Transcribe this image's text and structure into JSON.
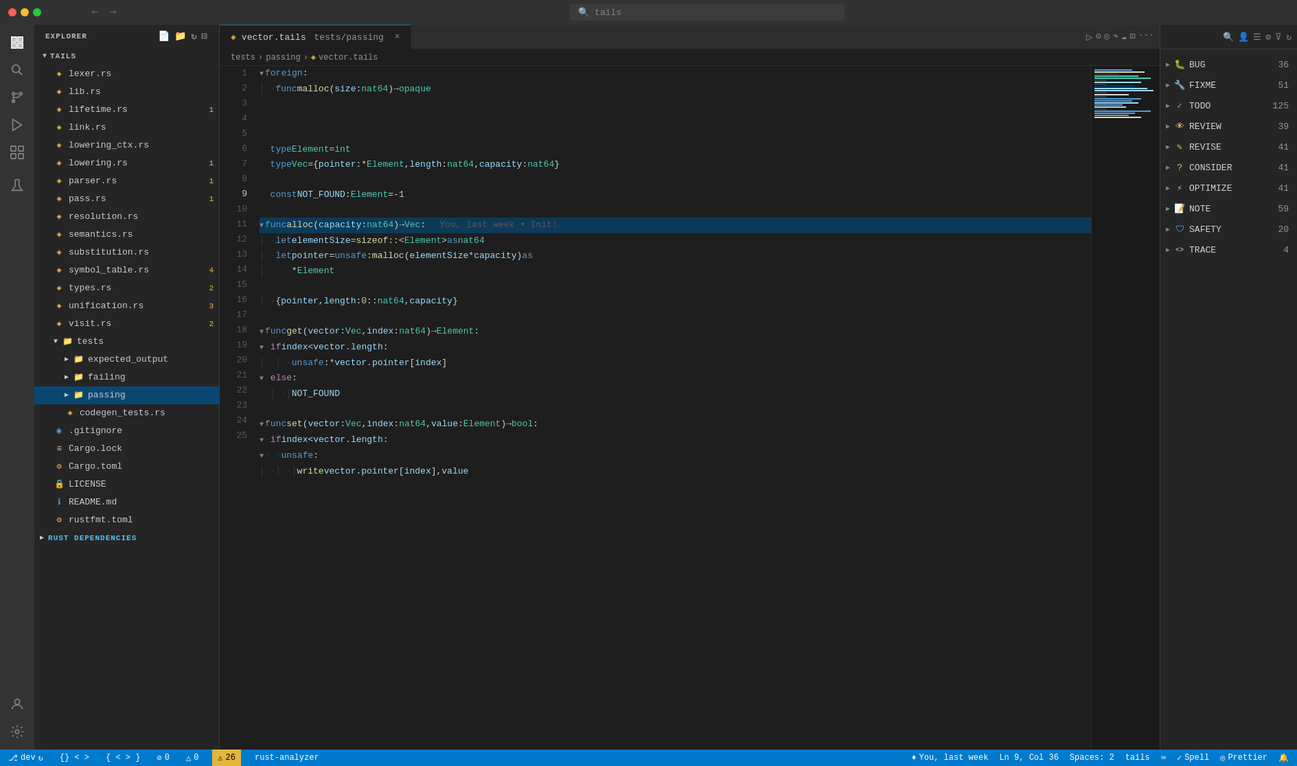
{
  "titleBar": {
    "searchPlaceholder": "tails"
  },
  "activityBar": {
    "items": [
      {
        "name": "explorer",
        "icon": "⧉",
        "active": true
      },
      {
        "name": "search",
        "icon": "🔍",
        "active": false
      },
      {
        "name": "source-control",
        "icon": "⑂",
        "active": false
      },
      {
        "name": "run",
        "icon": "▷",
        "active": false
      },
      {
        "name": "extensions",
        "icon": "⊞",
        "active": false
      },
      {
        "name": "test",
        "icon": "⚗",
        "active": false
      },
      {
        "name": "accounts",
        "icon": "◎",
        "active": false
      },
      {
        "name": "settings",
        "icon": "⚙",
        "active": false
      }
    ]
  },
  "sidebar": {
    "title": "EXPLORER",
    "section": "TAILS",
    "files": [
      {
        "name": "lexer.rs",
        "indent": 1,
        "type": "rs",
        "badge": ""
      },
      {
        "name": "lib.rs",
        "indent": 1,
        "type": "rs",
        "badge": ""
      },
      {
        "name": "lifetime.rs",
        "indent": 1,
        "type": "rs",
        "badge": "1"
      },
      {
        "name": "link.rs",
        "indent": 1,
        "type": "rs",
        "badge": ""
      },
      {
        "name": "lowering_ctx.rs",
        "indent": 1,
        "type": "rs",
        "badge": ""
      },
      {
        "name": "lowering.rs",
        "indent": 1,
        "type": "rs",
        "badge": "1"
      },
      {
        "name": "parser.rs",
        "indent": 1,
        "type": "rs",
        "badge": "1"
      },
      {
        "name": "pass.rs",
        "indent": 1,
        "type": "rs",
        "badge": "1"
      },
      {
        "name": "resolution.rs",
        "indent": 1,
        "type": "rs",
        "badge": ""
      },
      {
        "name": "semantics.rs",
        "indent": 1,
        "type": "rs",
        "badge": ""
      },
      {
        "name": "substitution.rs",
        "indent": 1,
        "type": "rs",
        "badge": ""
      },
      {
        "name": "symbol_table.rs",
        "indent": 1,
        "type": "rs",
        "badge": "4"
      },
      {
        "name": "types.rs",
        "indent": 1,
        "type": "rs",
        "badge": "2"
      },
      {
        "name": "unification.rs",
        "indent": 1,
        "type": "rs",
        "badge": "3"
      },
      {
        "name": "visit.rs",
        "indent": 1,
        "type": "rs",
        "badge": "2"
      }
    ],
    "testsFolder": "tests",
    "subfolders": [
      {
        "name": "expected_output",
        "indent": 2
      },
      {
        "name": "failing",
        "indent": 2
      },
      {
        "name": "passing",
        "indent": 2,
        "active": true
      }
    ],
    "testFiles": [
      {
        "name": "codegen_tests.rs",
        "indent": 2,
        "type": "rs"
      }
    ],
    "rootFiles": [
      {
        "name": ".gitignore",
        "icon": "◎"
      },
      {
        "name": "Cargo.lock",
        "icon": "≡"
      },
      {
        "name": "Cargo.toml",
        "icon": "⚙"
      },
      {
        "name": "LICENSE",
        "icon": "🔒"
      },
      {
        "name": "README.md",
        "icon": "ℹ"
      },
      {
        "name": "rustfmt.toml",
        "icon": "⚙"
      }
    ],
    "rustDeps": "RUST DEPENDENCIES"
  },
  "tabs": [
    {
      "name": "vector.tails",
      "path": "tests/passing",
      "active": true,
      "modified": false
    }
  ],
  "breadcrumb": {
    "parts": [
      "tests",
      "passing",
      "vector.tails"
    ]
  },
  "codeLines": [
    {
      "num": 1,
      "fold": true,
      "content": "foreign:"
    },
    {
      "num": 2,
      "fold": false,
      "content": "  func malloc(size: nat64) → opaque"
    },
    {
      "num": 3,
      "fold": false,
      "content": ""
    },
    {
      "num": 4,
      "fold": false,
      "content": "  type Element = int"
    },
    {
      "num": 5,
      "fold": false,
      "content": "  type Vec = {pointer: *Element, length: nat64, capacity: nat64}"
    },
    {
      "num": 6,
      "fold": false,
      "content": ""
    },
    {
      "num": 7,
      "fold": false,
      "content": "  const NOT_FOUND: Element = -1"
    },
    {
      "num": 8,
      "fold": false,
      "content": ""
    },
    {
      "num": 9,
      "fold": true,
      "content": "func alloc(capacity: nat64) → Vec:",
      "ghost": "You, last week • Init:"
    },
    {
      "num": 10,
      "fold": false,
      "content": "  let elementSize = sizeof::<Element> as nat64"
    },
    {
      "num": 11,
      "fold": false,
      "content": "  let pointer = unsafe: malloc(elementSize * capacity) as"
    },
    {
      "num": 11.5,
      "fold": false,
      "content": "      *Element"
    },
    {
      "num": 12,
      "fold": false,
      "content": ""
    },
    {
      "num": 13,
      "fold": false,
      "content": "  {pointer, length: 0::nat64, capacity}"
    },
    {
      "num": 14,
      "fold": false,
      "content": ""
    },
    {
      "num": 15,
      "fold": true,
      "content": "func get(vector: Vec, index: nat64) → Element:"
    },
    {
      "num": 16,
      "fold": true,
      "content": "  if index < vector.length:"
    },
    {
      "num": 17,
      "fold": false,
      "content": "    unsafe: *vector.pointer[index]"
    },
    {
      "num": 18,
      "fold": true,
      "content": "  else:"
    },
    {
      "num": 19,
      "fold": false,
      "content": "    NOT_FOUND"
    },
    {
      "num": 20,
      "fold": false,
      "content": ""
    },
    {
      "num": 21,
      "fold": true,
      "content": "func set(vector: Vec, index: nat64, value: Element) → bool:"
    },
    {
      "num": 22,
      "fold": true,
      "content": "  if index < vector.length:"
    },
    {
      "num": 23,
      "fold": true,
      "content": "    unsafe:"
    },
    {
      "num": 24,
      "fold": false,
      "content": "      write vector.pointer[index], value"
    },
    {
      "num": 25,
      "fold": false,
      "content": ""
    }
  ],
  "annotations": {
    "items": [
      {
        "name": "BUG",
        "count": "36",
        "color": "#f44747",
        "icon": "🐛"
      },
      {
        "name": "FIXME",
        "count": "51",
        "color": "#f44747",
        "icon": "🔧"
      },
      {
        "name": "TODO",
        "count": "125",
        "color": "#73c991",
        "icon": "✓"
      },
      {
        "name": "REVIEW",
        "count": "39",
        "color": "#e8c06e",
        "icon": "👁"
      },
      {
        "name": "REVISE",
        "count": "41",
        "color": "#e8c06e",
        "icon": "✎"
      },
      {
        "name": "CONSIDER",
        "count": "41",
        "color": "#e8c06e",
        "icon": "?"
      },
      {
        "name": "OPTIMIZE",
        "count": "41",
        "color": "#e8c06e",
        "icon": "⚡"
      },
      {
        "name": "NOTE",
        "count": "59",
        "color": "#569cd6",
        "icon": "📝"
      },
      {
        "name": "SAFETY",
        "count": "20",
        "color": "#569cd6",
        "icon": "🛡"
      },
      {
        "name": "TRACE",
        "count": "4",
        "color": "#d4d4d4",
        "icon": "<>"
      }
    ]
  },
  "statusBar": {
    "branch": "dev",
    "errors": "0",
    "warnings": "0",
    "warningCount": "26",
    "analyzer": "rust-analyzer",
    "position": "Ln 9, Col 36",
    "spaces": "Spaces: 2",
    "encoding": "tails",
    "spell": "Spell",
    "prettier": "Prettier",
    "gitStatus": "You, last week"
  }
}
